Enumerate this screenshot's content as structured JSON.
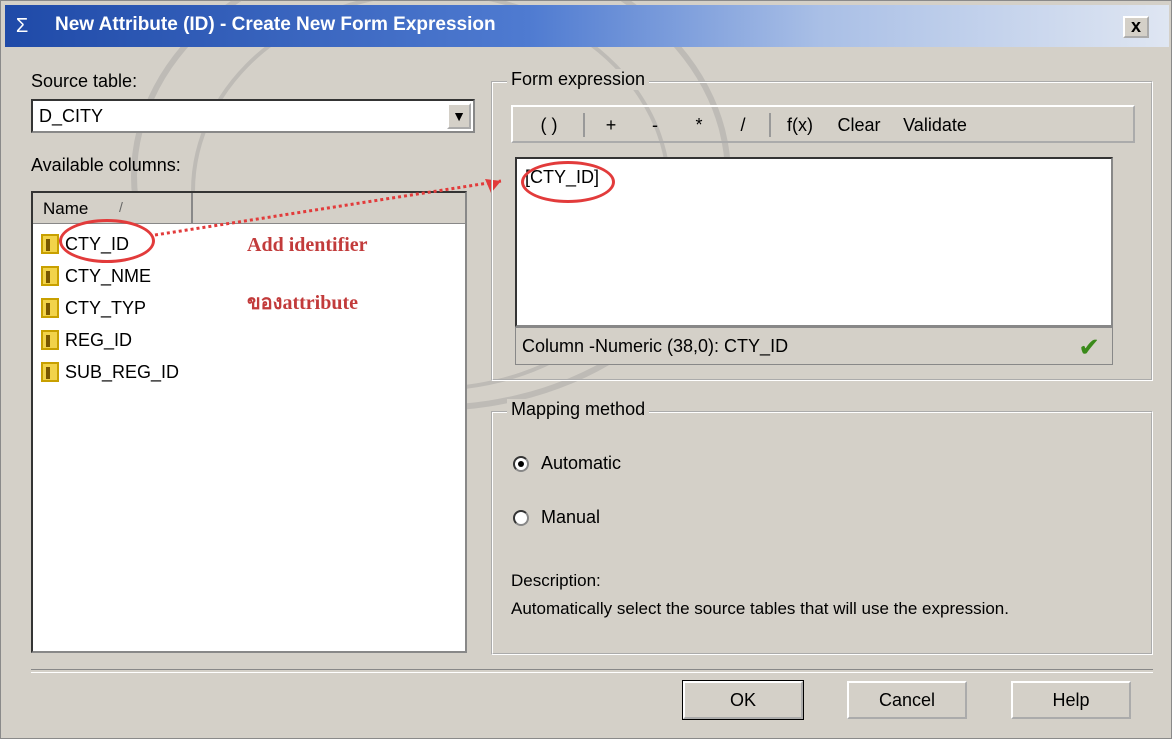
{
  "window": {
    "title": "New Attribute (ID) - Create New Form Expression",
    "close_label": "x"
  },
  "source_table": {
    "label": "Source table:",
    "value": "D_CITY"
  },
  "available_columns": {
    "label": "Available columns:",
    "header_name": "Name",
    "items": [
      "CTY_ID",
      "CTY_NME",
      "CTY_TYP",
      "REG_ID",
      "SUB_REG_ID"
    ]
  },
  "annotations": {
    "line1": "Add identifier",
    "line2": "ของattribute"
  },
  "form_expression": {
    "label": "Form expression",
    "toolbar": {
      "parens": "( )",
      "plus": "+",
      "minus": "-",
      "multiply": "*",
      "divide": "/",
      "func": "f(x)",
      "clear": "Clear",
      "validate": "Validate"
    },
    "expression": "[CTY_ID]",
    "status": "Column -Numeric (38,0): CTY_ID"
  },
  "mapping": {
    "label": "Mapping method",
    "automatic": "Automatic",
    "manual": "Manual",
    "selected": "Automatic",
    "description_label": "Description:",
    "description": "Automatically select the source tables that will use the expression."
  },
  "buttons": {
    "ok": "OK",
    "cancel": "Cancel",
    "help": "Help"
  }
}
